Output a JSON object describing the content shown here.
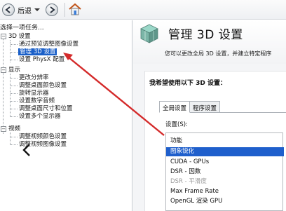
{
  "toolbar": {
    "back_label": "后退"
  },
  "tree": {
    "header": "选择一项任务...",
    "categories": [
      {
        "label": "3D 设置",
        "expander": "−",
        "items": [
          {
            "label": "通过预览调整图像设置"
          },
          {
            "label": "管理 3D 设置",
            "selected": true
          },
          {
            "label": "设置 PhysX 配置"
          }
        ]
      },
      {
        "label": "显示",
        "expander": "−",
        "items": [
          {
            "label": "更改分辨率"
          },
          {
            "label": "调整桌面颜色设置"
          },
          {
            "label": "旋转显示器"
          },
          {
            "label": "设置数字音频"
          },
          {
            "label": "调整桌面尺寸和位置"
          },
          {
            "label": "设置多个显示器"
          }
        ]
      },
      {
        "label": "视频",
        "expander": "−",
        "items": [
          {
            "label": "调整视频颜色设置"
          },
          {
            "label": "调整视频图像设置"
          }
        ]
      }
    ]
  },
  "main": {
    "title": "管理 3D 设置",
    "description": "您可以更改全局 3D 设置，并建立特定程序",
    "section_heading": "我希望使用以下 3D 设置：",
    "tabs": [
      {
        "label": "全局设置",
        "active": true
      },
      {
        "label": "程序设置",
        "active": false
      }
    ],
    "settings_label": "设置(S):",
    "table": {
      "column_header": "功能",
      "rows": [
        {
          "label": "图象锐化",
          "selected": true,
          "dim": false
        },
        {
          "label": "CUDA - GPUs",
          "selected": false,
          "dim": false
        },
        {
          "label": "DSR - 因数",
          "selected": false,
          "dim": false
        },
        {
          "label": "DSR - 平滑度",
          "selected": false,
          "dim": true
        },
        {
          "label": "Max Frame Rate",
          "selected": false,
          "dim": false
        },
        {
          "label": "OpenGL 渲染 GPU",
          "selected": false,
          "dim": false
        }
      ]
    }
  },
  "colors": {
    "selection": "#1a5fc8",
    "annotation_arrow": "#d42a2a",
    "nvidia_green": "#76b900"
  }
}
